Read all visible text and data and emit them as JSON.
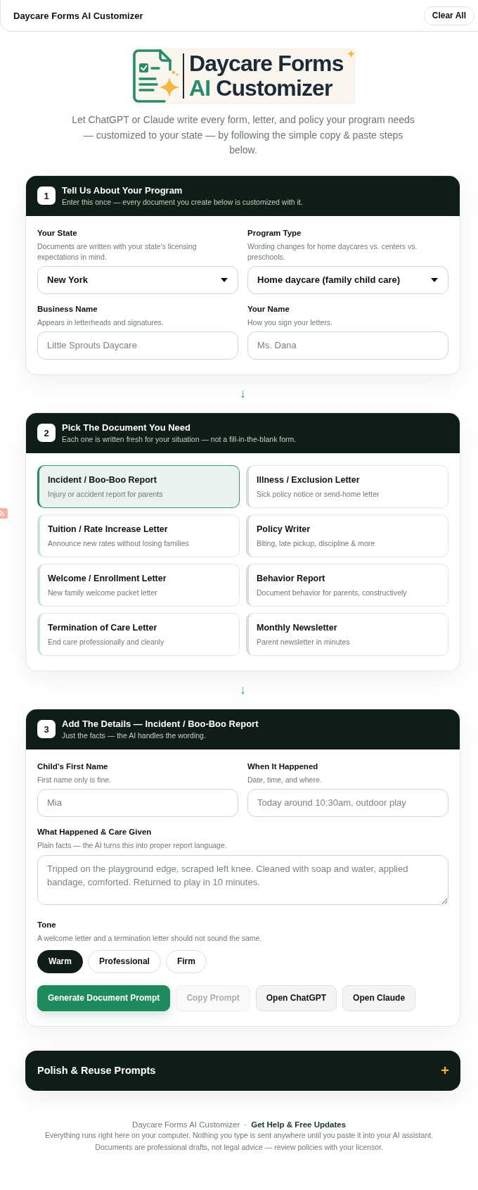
{
  "top_bar": {
    "title": "Daycare Forms AI Customizer",
    "clear_button": "Clear All"
  },
  "logo": {
    "line_1": "Daycare Forms",
    "line_2_accent": "AI",
    "line_2": "Customizer"
  },
  "intro": "Let ChatGPT or Claude write every form, letter, and policy your program needs — customized to your state — by following the simple copy & paste steps below.",
  "steps": [
    {
      "number": "1",
      "title": "Tell Us About Your Program",
      "subtitle": "Enter this once — every document you create below is customized with it.",
      "fields": [
        {
          "kind": "select",
          "label": "Your State",
          "help": "Documents are written with your state's licensing expectations in mind.",
          "value": "New York"
        },
        {
          "kind": "select",
          "label": "Program Type",
          "help": "Wording changes for home daycares vs. centers vs. preschools.",
          "value": "Home daycare (family child care)"
        },
        {
          "kind": "input",
          "label": "Business Name",
          "help": "Appears in letterheads and signatures.",
          "placeholder": "Little Sprouts Daycare"
        },
        {
          "kind": "input",
          "label": "Your Name",
          "help": "How you sign your letters.",
          "placeholder": "Ms. Dana"
        }
      ],
      "arrow_below": "↓"
    },
    {
      "number": "2",
      "title": "Pick The Document You Need",
      "subtitle": "Each one is written fresh for your situation — not a fill-in-the-blank form.",
      "documents": [
        {
          "title": "Incident / Boo-Boo Report",
          "description": "Injury or accident report for parents",
          "selected": true
        },
        {
          "title": "Illness / Exclusion Letter",
          "description": "Sick policy notice or send-home letter",
          "selected": false
        },
        {
          "title": "Tuition / Rate Increase Letter",
          "description": "Announce new rates without losing families",
          "selected": false
        },
        {
          "title": "Policy Writer",
          "description": "Biting, late pickup, discipline & more",
          "selected": false
        },
        {
          "title": "Welcome / Enrollment Letter",
          "description": "New family welcome packet letter",
          "selected": false
        },
        {
          "title": "Behavior Report",
          "description": "Document behavior for parents, constructively",
          "selected": false
        },
        {
          "title": "Termination of Care Letter",
          "description": "End care professionally and cleanly",
          "selected": false
        },
        {
          "title": "Monthly Newsletter",
          "description": "Parent newsletter in minutes",
          "selected": false
        }
      ],
      "arrow_below": "↓"
    },
    {
      "number": "3",
      "title": "Add The Details — Incident / Boo-Boo Report",
      "subtitle": "Just the facts — the AI handles the wording.",
      "fields": [
        {
          "kind": "input",
          "label": "Child's First Name",
          "help": "First name only is fine.",
          "placeholder": "Mia"
        },
        {
          "kind": "input",
          "label": "When It Happened",
          "help": "Date, time, and where.",
          "placeholder": "Today around 10:30am, outdoor play"
        },
        {
          "kind": "textarea",
          "label": "What Happened & Care Given",
          "help": "Plain facts — the AI turns this into proper report language.",
          "placeholder": "Tripped on the playground edge, scraped left knee. Cleaned with soap and water, applied bandage, comforted. Returned to play in 10 minutes."
        }
      ],
      "tone": {
        "label": "Tone",
        "help": "A welcome letter and a termination letter should not sound the same.",
        "options": [
          {
            "label": "Warm",
            "selected": true
          },
          {
            "label": "Professional",
            "selected": false
          },
          {
            "label": "Firm",
            "selected": false
          }
        ]
      },
      "actions": [
        {
          "label": "Generate Document Prompt",
          "kind": "primary",
          "disabled": false
        },
        {
          "label": "Copy Prompt",
          "kind": "secondary",
          "disabled": true
        },
        {
          "label": "Open ChatGPT",
          "kind": "secondary",
          "disabled": false
        },
        {
          "label": "Open Claude",
          "kind": "secondary",
          "disabled": false
        }
      ]
    }
  ],
  "accordion": {
    "title": "Polish & Reuse Prompts",
    "toggle": "+"
  },
  "footer": {
    "brand": "Daycare Forms AI Customizer",
    "separator": "·",
    "link": "Get Help & Free Updates",
    "notes": [
      "Everything runs right here on your computer. Nothing you type is sent anywhere until you paste it into your AI assistant.",
      "Documents are professional drafts, not legal advice — review policies with your licensor."
    ]
  }
}
